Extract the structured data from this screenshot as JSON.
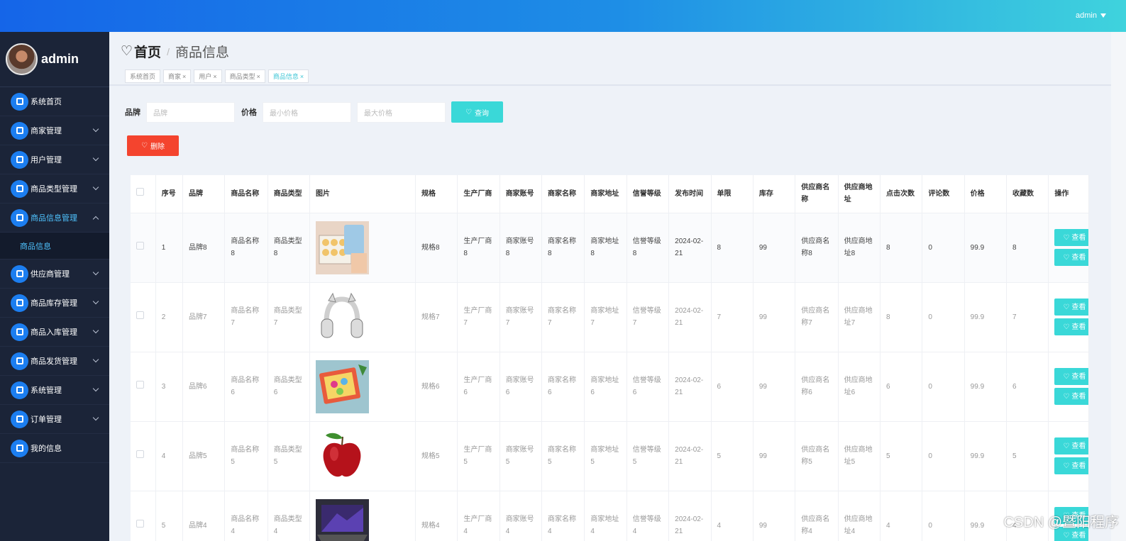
{
  "topbar": {
    "user": "admin"
  },
  "sidebar": {
    "user_name": "admin",
    "items": [
      {
        "label": "系统首页",
        "icon": "home-icon",
        "chevron": false
      },
      {
        "label": "商家管理",
        "icon": "clipboard-icon",
        "chevron": true
      },
      {
        "label": "用户管理",
        "icon": "briefcase-icon",
        "chevron": true
      },
      {
        "label": "商品类型管理",
        "icon": "grid-icon",
        "chevron": true
      },
      {
        "label": "商品信息管理",
        "icon": "flag-icon",
        "chevron": true,
        "active": true
      },
      {
        "label": "供应商管理",
        "icon": "truck-icon",
        "chevron": true
      },
      {
        "label": "商品库存管理",
        "icon": "clipboard-icon",
        "chevron": true
      },
      {
        "label": "商品入库管理",
        "icon": "book-icon",
        "chevron": true
      },
      {
        "label": "商品发货管理",
        "icon": "bar-chart-icon",
        "chevron": true
      },
      {
        "label": "系统管理",
        "icon": "grid-icon",
        "chevron": true
      },
      {
        "label": "订单管理",
        "icon": "sliders-icon",
        "chevron": true
      },
      {
        "label": "我的信息",
        "icon": "card-icon",
        "chevron": false
      }
    ],
    "submenu": "商品信息"
  },
  "breadcrumb": {
    "home": "首页",
    "separator": "/",
    "current": "商品信息"
  },
  "tabs": [
    {
      "label": "系统首页",
      "closable": false
    },
    {
      "label": "商家",
      "closable": true
    },
    {
      "label": "用户",
      "closable": true
    },
    {
      "label": "商品类型",
      "closable": true
    },
    {
      "label": "商品信息",
      "closable": true,
      "active": true
    }
  ],
  "search": {
    "brand_label": "品牌",
    "brand_placeholder": "品牌",
    "price_label": "价格",
    "min_placeholder": "最小价格",
    "max_placeholder": "最大价格",
    "query_label": "查询",
    "delete_label": "删除"
  },
  "table": {
    "headers": [
      "",
      "序号",
      "品牌",
      "商品名称",
      "商品类型",
      "图片",
      "规格",
      "生产厂商",
      "商家账号",
      "商家名称",
      "商家地址",
      "信誉等级",
      "发布时间",
      "单限",
      "库存",
      "供应商名称",
      "供应商地址",
      "点击次数",
      "评论数",
      "价格",
      "收藏数",
      "操作"
    ],
    "op_label": "查看",
    "rows": [
      {
        "idx": "1",
        "brand": "品牌8",
        "name": "商品名称8",
        "type": "商品类型8",
        "image": "gift-box",
        "spec": "规格8",
        "maker": "生产厂商8",
        "account": "商家账号8",
        "merchant": "商家名称8",
        "address": "商家地址8",
        "credit": "信誉等级8",
        "date": "2024-02-21",
        "limit": "8",
        "stock": "99",
        "supplier": "供应商名称8",
        "supplier_addr": "供应商地址8",
        "clicks": "8",
        "comments": "0",
        "price": "99.9",
        "favs": "8"
      },
      {
        "idx": "2",
        "brand": "品牌7",
        "name": "商品名称7",
        "type": "商品类型7",
        "image": "headphones",
        "spec": "规格7",
        "maker": "生产厂商7",
        "account": "商家账号7",
        "merchant": "商家名称7",
        "address": "商家地址7",
        "credit": "信誉等级7",
        "date": "2024-02-21",
        "limit": "7",
        "stock": "99",
        "supplier": "供应商名称7",
        "supplier_addr": "供应商地址7",
        "clicks": "8",
        "comments": "0",
        "price": "99.9",
        "favs": "7"
      },
      {
        "idx": "3",
        "brand": "品牌6",
        "name": "商品名称6",
        "type": "商品类型6",
        "image": "toy-box",
        "spec": "规格6",
        "maker": "生产厂商6",
        "account": "商家账号6",
        "merchant": "商家名称6",
        "address": "商家地址6",
        "credit": "信誉等级6",
        "date": "2024-02-21",
        "limit": "6",
        "stock": "99",
        "supplier": "供应商名称6",
        "supplier_addr": "供应商地址6",
        "clicks": "6",
        "comments": "0",
        "price": "99.9",
        "favs": "6"
      },
      {
        "idx": "4",
        "brand": "品牌5",
        "name": "商品名称5",
        "type": "商品类型5",
        "image": "apple",
        "spec": "规格5",
        "maker": "生产厂商5",
        "account": "商家账号5",
        "merchant": "商家名称5",
        "address": "商家地址5",
        "credit": "信誉等级5",
        "date": "2024-02-21",
        "limit": "5",
        "stock": "99",
        "supplier": "供应商名称5",
        "supplier_addr": "供应商地址5",
        "clicks": "5",
        "comments": "0",
        "price": "99.9",
        "favs": "5"
      },
      {
        "idx": "5",
        "brand": "品牌4",
        "name": "商品名称4",
        "type": "商品类型4",
        "image": "laptop",
        "spec": "规格4",
        "maker": "生产厂商4",
        "account": "商家账号4",
        "merchant": "商家名称4",
        "address": "商家地址4",
        "credit": "信誉等级4",
        "date": "2024-02-21",
        "limit": "4",
        "stock": "99",
        "supplier": "供应商名称4",
        "supplier_addr": "供应商地址4",
        "clicks": "4",
        "comments": "0",
        "price": "99.9",
        "favs": "4"
      }
    ]
  },
  "watermark": "CSDN @暨阳程序",
  "colors": {
    "accent": "#3ad8d8",
    "danger": "#f4442e",
    "sidebar": "#1b2438",
    "primary": "#1c7ef0"
  }
}
